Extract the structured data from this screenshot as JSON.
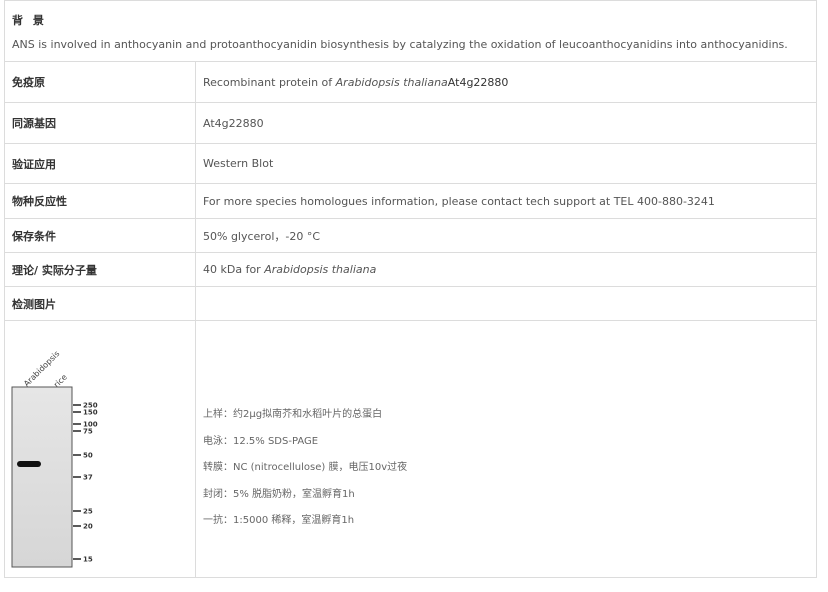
{
  "background": {
    "title": "背 景",
    "text": "ANS is involved in anthocyanin and protoanthocyanidin biosynthesis by catalyzing the oxidation of leucoanthocyanidins into anthocyanidins."
  },
  "rows": {
    "immunogen": {
      "label": "免疫原",
      "prefix": "Recombinant protein of ",
      "species": "Arabidopsis thaliana",
      "gene": " At4g22880"
    },
    "homolog": {
      "label": "同源基因",
      "value": "At4g22880"
    },
    "application": {
      "label": "验证应用",
      "value": "Western Blot"
    },
    "reactivity": {
      "label": "物种反应性",
      "value": "For more species homologues information, please contact tech support at TEL 400-880-3241"
    },
    "storage": {
      "label": "保存条件",
      "value": "50% glycerol，-20 °C"
    },
    "mw": {
      "label": "理论/ 实际分子量",
      "prefix": "40 kDa for ",
      "species": "Arabidopsis thaliana"
    },
    "images": {
      "label": "检测图片"
    }
  },
  "blot": {
    "lanes": [
      "Arabidopsis",
      "rice"
    ],
    "markers": [
      "250",
      "150",
      "100",
      "75",
      "50",
      "37",
      "25",
      "20",
      "15"
    ]
  },
  "notes": [
    "上样：约2μg拟南芥和水稻叶片的总蛋白",
    "电泳：12.5% SDS-PAGE",
    "转膜：NC (nitrocellulose) 膜，电压10v过夜",
    "封闭：5% 脱脂奶粉，室温孵育1h",
    "一抗：1:5000 稀释，室温孵育1h"
  ]
}
